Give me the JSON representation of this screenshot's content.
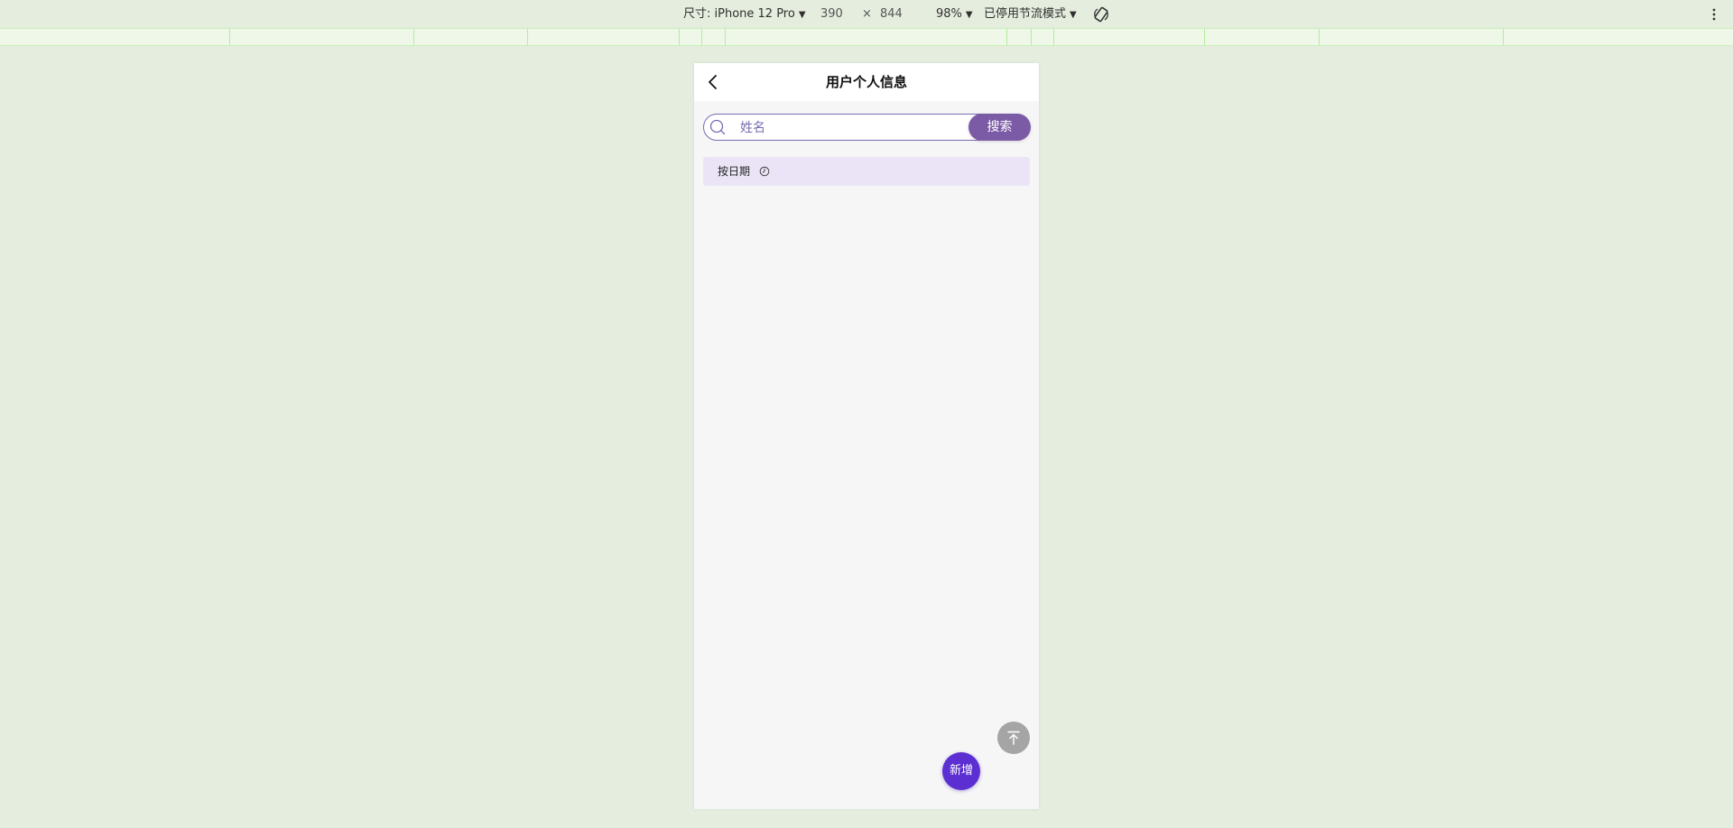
{
  "toolbar": {
    "dimensions_label": "尺寸: iPhone 12 Pro",
    "width_value": "390",
    "times_symbol": "×",
    "height_value": "844",
    "zoom": "98%",
    "throttle_label": "已停用节流模式"
  },
  "app": {
    "title": "用户个人信息",
    "search": {
      "placeholder": "姓名",
      "value": "",
      "button_label": "搜索"
    },
    "filter": {
      "label": "按日期"
    },
    "add_button_label": "新增"
  },
  "colors": {
    "accent": "#7b5aa6",
    "add_button": "#5b2fd1",
    "filter_bg": "#ebe4f7"
  }
}
